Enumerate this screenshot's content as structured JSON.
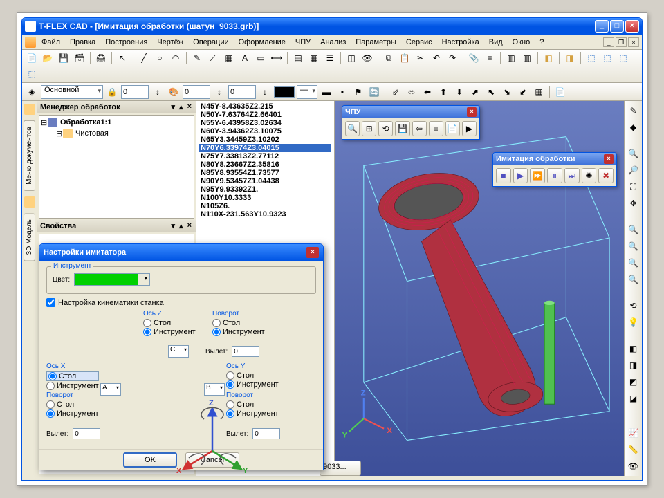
{
  "titlebar": {
    "title": "T-FLEX CAD - [Имитация обработки (шатун_9033.grb)]"
  },
  "menu": {
    "items": [
      "Файл",
      "Правка",
      "Построения",
      "Чертёж",
      "Операции",
      "Оформление",
      "ЧПУ",
      "Анализ",
      "Параметры",
      "Сервис",
      "Настройка",
      "Вид",
      "Окно",
      "?"
    ]
  },
  "toolbar2": {
    "layer_label": "Основной",
    "spin1": "0",
    "spin2": "0",
    "spin3": "0",
    "color": "#000000"
  },
  "side_tabs": {
    "tab1": "Меню документов",
    "tab2": "3D Модель"
  },
  "tree_panel": {
    "title": "Менеджер обработок",
    "nodes": [
      {
        "indent": 0,
        "label": "Обработка1:1",
        "bold": true
      },
      {
        "indent": 1,
        "label": "Чистовая",
        "bold": false
      }
    ]
  },
  "props_panel": {
    "title": "Свойства"
  },
  "gcode": {
    "lines": [
      "N45Y-8.43635Z2.215",
      "N50Y-7.63764Z2.66401",
      "N55Y-6.43958Z3.02634",
      "N60Y-3.94362Z3.10075",
      "N65Y3.34459Z3.10202",
      "N70Y6.33974Z3.04015",
      "N75Y7.33813Z2.77112",
      "N80Y8.23667Z2.35816",
      "N85Y8.93554Z1.73577",
      "N90Y9.53457Z1.04438",
      "N95Y9.93392Z1.",
      "N100Y10.3333",
      "N105Z6.",
      "N110X-231.563Y10.9323"
    ],
    "selected_index": 5
  },
  "float_cnc": {
    "title": "ЧПУ"
  },
  "float_sim": {
    "title": "Имитация обработки"
  },
  "dialog": {
    "title": "Настройки имитатора",
    "group_tool": "Инструмент",
    "color_label": "Цвет:",
    "kinematics_check": "Настройка кинематики станка",
    "axis_z": "Ось Z",
    "axis_x": "Ось X",
    "axis_y": "Ось Y",
    "rotation": "Поворот",
    "opt_table": "Стол",
    "opt_tool": "Инструмент",
    "overhang": "Вылет:",
    "overhang_val": "0",
    "combo_a": "A",
    "combo_b": "B",
    "combo_c": "C",
    "ok": "OK",
    "cancel": "Cancel"
  },
  "axis_viewport": {
    "x": "X",
    "y": "Y",
    "z": "Z"
  },
  "taskbar": {
    "doc": "9033..."
  }
}
